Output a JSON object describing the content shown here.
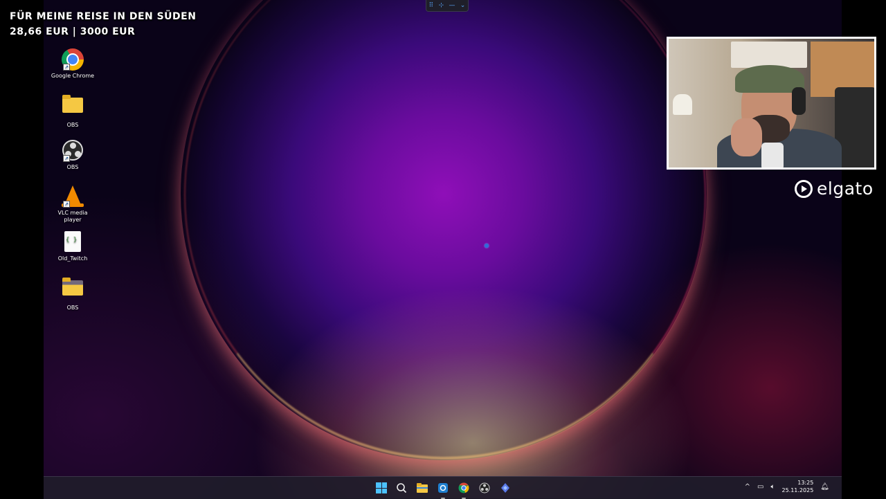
{
  "overlay": {
    "line1": "Für meine Reise in den Süden",
    "line2": "28,66 EUR | 3000 EUR"
  },
  "desktop_icons": [
    {
      "label": "Google Chrome",
      "icon": "chrome-icon"
    },
    {
      "label": "OBS",
      "icon": "folder-icon"
    },
    {
      "label": "OBS",
      "icon": "obs-icon"
    },
    {
      "label": "VLC media player",
      "icon": "vlc-icon"
    },
    {
      "label": "Old_Twitch",
      "icon": "json-file-icon"
    },
    {
      "label": "OBS",
      "icon": "folder-open-icon"
    }
  ],
  "branding": {
    "elgato_label": "elgato"
  },
  "taskbar": {
    "apps": [
      "start-icon",
      "search-icon",
      "file-explorer-icon",
      "snipping-tool-icon",
      "chrome-icon",
      "obs-icon",
      "app-icon"
    ],
    "time": "13:25",
    "date": "25.11.2025"
  },
  "colors": {
    "accent": "#4cc2ff",
    "wallpaper_core": "#8f0fb8",
    "wallpaper_rim": "#ffcf8a"
  }
}
